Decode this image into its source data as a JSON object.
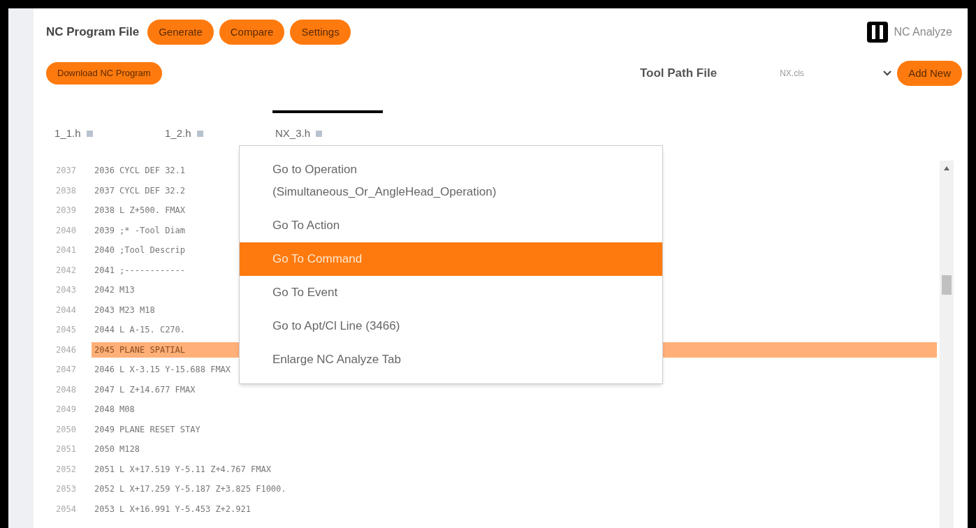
{
  "header": {
    "title": "NC Program File",
    "buttons": [
      "Generate",
      "Compare",
      "Settings"
    ],
    "brand": "NC Analyze"
  },
  "toolbar": {
    "download_button": "Download NC Program",
    "tool_path_label": "Tool Path File",
    "tool_path_value": "NX.cls",
    "add_button": "Add New"
  },
  "tabs": [
    {
      "label": "1_1.h",
      "selected": false
    },
    {
      "label": "1_2.h",
      "selected": false
    },
    {
      "label": "NX_3.h",
      "selected": true
    }
  ],
  "code_lines": [
    {
      "number": "2037",
      "text": "2036 CYCL DEF 32.1",
      "highlighted": false
    },
    {
      "number": "2038",
      "text": "2037 CYCL DEF 32.2",
      "highlighted": false
    },
    {
      "number": "2039",
      "text": "2038 L Z+500. FMAX",
      "highlighted": false
    },
    {
      "number": "2040",
      "text": "2039 ;* -Tool Diam",
      "highlighted": false
    },
    {
      "number": "2041",
      "text": "2040 ;Tool Descrip",
      "highlighted": false
    },
    {
      "number": "2042",
      "text": "2041 ;------------",
      "highlighted": false
    },
    {
      "number": "2043",
      "text": "2042 M13",
      "highlighted": false
    },
    {
      "number": "2044",
      "text": "2043 M23 M18",
      "highlighted": false
    },
    {
      "number": "2045",
      "text": "2044 L A-15. C270.",
      "highlighted": false
    },
    {
      "number": "2046",
      "text": "2045 PLANE SPATIAL",
      "highlighted": true
    },
    {
      "number": "2047",
      "text": "2046 L X-3.15 Y-15.688 FMAX",
      "highlighted": false
    },
    {
      "number": "2048",
      "text": "2047 L Z+14.677 FMAX",
      "highlighted": false
    },
    {
      "number": "2049",
      "text": "2048 M08",
      "highlighted": false
    },
    {
      "number": "2050",
      "text": "2049 PLANE RESET STAY",
      "highlighted": false
    },
    {
      "number": "2051",
      "text": "2050 M128",
      "highlighted": false
    },
    {
      "number": "2052",
      "text": "2051 L X+17.519 Y-5.11 Z+4.767 FMAX",
      "highlighted": false
    },
    {
      "number": "2053",
      "text": "2052 L X+17.259 Y-5.187 Z+3.825 F1000.",
      "highlighted": false
    },
    {
      "number": "2054",
      "text": "2053 L X+16.991 Y-5.453 Z+2.921",
      "highlighted": false
    }
  ],
  "context_menu": [
    {
      "label": "Go to Operation (Simultaneous_Or_AngleHead_Operation)",
      "selected": false
    },
    {
      "label": "Go To Action",
      "selected": false
    },
    {
      "label": "Go To Command",
      "selected": true
    },
    {
      "label": "Go To Event",
      "selected": false
    },
    {
      "label": "Go to Apt/Cl Line (3466)",
      "selected": false
    },
    {
      "label": "Enlarge NC Analyze Tab",
      "selected": false
    }
  ]
}
